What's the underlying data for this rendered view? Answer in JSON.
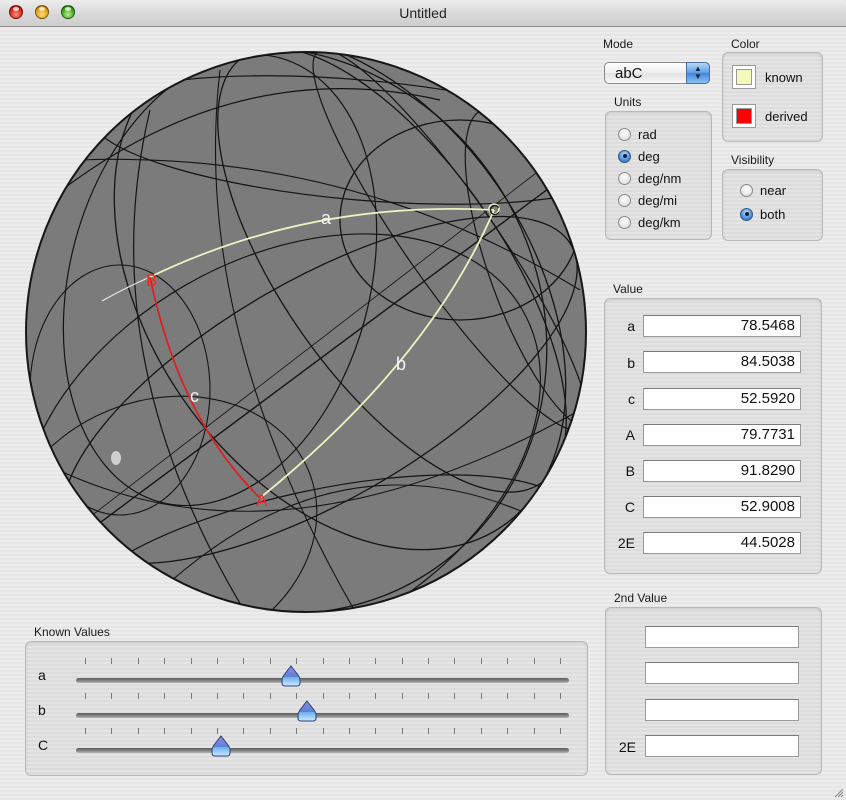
{
  "window": {
    "title": "Untitled"
  },
  "sphere": {
    "vertices": [
      {
        "id": "A",
        "label": "A",
        "color": "#ff2020"
      },
      {
        "id": "B",
        "label": "B",
        "color": "#ff2020"
      },
      {
        "id": "C",
        "label": "C",
        "color": "#f3f7c2"
      }
    ],
    "sides": [
      {
        "id": "a",
        "label": "a",
        "from": "B",
        "to": "C",
        "kind": "known"
      },
      {
        "id": "b",
        "label": "b",
        "from": "A",
        "to": "C",
        "kind": "known"
      },
      {
        "id": "c",
        "label": "c",
        "from": "A",
        "to": "B",
        "kind": "derived"
      }
    ]
  },
  "mode": {
    "label": "Mode",
    "selected": "abC"
  },
  "units": {
    "label": "Units",
    "options": [
      {
        "label": "rad",
        "selected": false
      },
      {
        "label": "deg",
        "selected": true
      },
      {
        "label": "deg/nm",
        "selected": false
      },
      {
        "label": "deg/mi",
        "selected": false
      },
      {
        "label": "deg/km",
        "selected": false
      }
    ]
  },
  "color": {
    "label": "Color",
    "items": [
      {
        "label": "known",
        "color": "#f3f9b8"
      },
      {
        "label": "derived",
        "color": "#ff0000"
      }
    ]
  },
  "visibility": {
    "label": "Visibility",
    "options": [
      {
        "label": "near",
        "selected": false
      },
      {
        "label": "both",
        "selected": true
      }
    ]
  },
  "value": {
    "label": "Value",
    "rows": [
      {
        "label": "a",
        "value": "78.5468"
      },
      {
        "label": "b",
        "value": "84.5038"
      },
      {
        "label": "c",
        "value": "52.5920"
      },
      {
        "label": "A",
        "value": "79.7731"
      },
      {
        "label": "B",
        "value": "91.8290"
      },
      {
        "label": "C",
        "value": "52.9008"
      },
      {
        "label": "2E",
        "value": "44.5028"
      }
    ]
  },
  "second_value": {
    "label": "2nd Value",
    "rows": [
      {
        "label": "",
        "value": ""
      },
      {
        "label": "",
        "value": ""
      },
      {
        "label": "",
        "value": ""
      },
      {
        "label": "2E",
        "value": ""
      }
    ]
  },
  "known_values": {
    "label": "Known Values",
    "range": [
      0,
      180
    ],
    "tick_count": 19,
    "sliders": [
      {
        "label": "a",
        "value": 78.5468
      },
      {
        "label": "b",
        "value": 84.5038
      },
      {
        "label": "C",
        "value": 52.9008
      }
    ]
  }
}
